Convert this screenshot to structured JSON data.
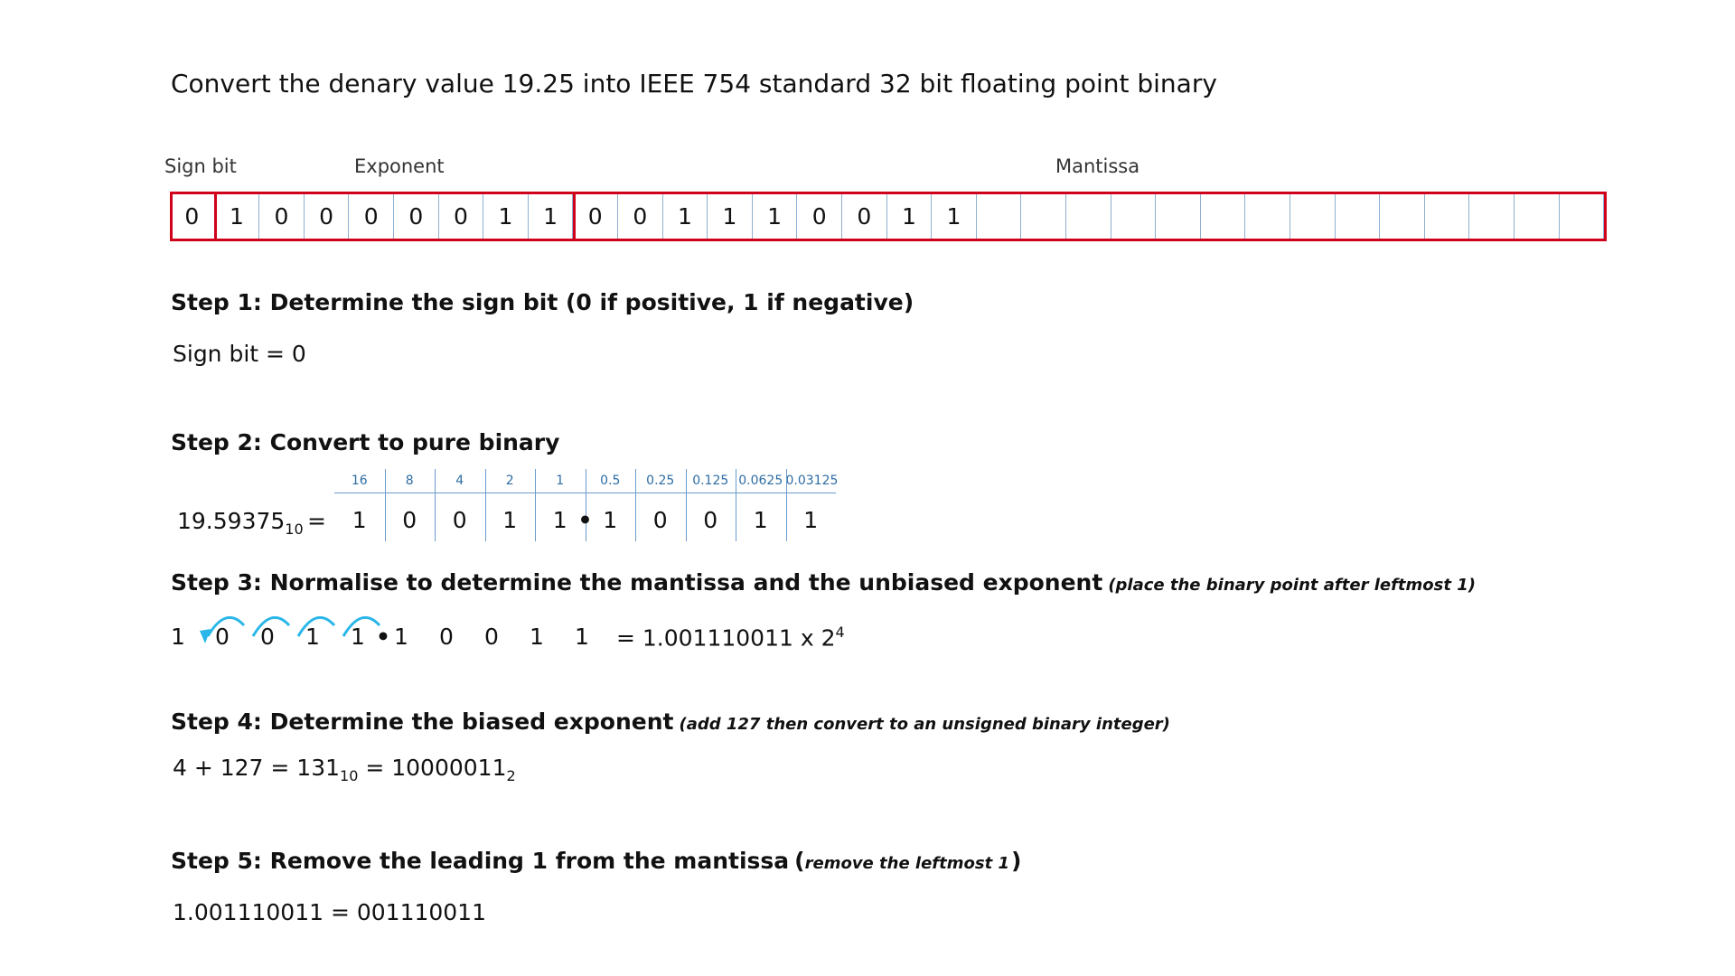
{
  "title": "Convert the denary value 19.25 into IEEE 754 standard 32 bit floating point binary",
  "fields": {
    "sign_label": "Sign bit",
    "exponent_label": "Exponent",
    "mantissa_label": "Mantissa"
  },
  "bits": [
    "0",
    "1",
    "0",
    "0",
    "0",
    "0",
    "0",
    "1",
    "1",
    "0",
    "0",
    "1",
    "1",
    "1",
    "0",
    "0",
    "1",
    "1",
    "",
    "",
    "",
    "",
    "",
    "",
    "",
    "",
    "",
    "",
    "",
    "",
    "",
    ""
  ],
  "colors": {
    "group_border": "#d0021b",
    "cell_divider": "#8fb0d0",
    "place_value_text": "#2e6da4",
    "arc": "#29b6e8"
  },
  "step1": {
    "heading": "Step 1: Determine the sign bit (0 if positive, 1 if negative)",
    "value": "Sign bit  =  0"
  },
  "step2": {
    "heading": "Step 2: Convert to pure binary",
    "number": "19.59375",
    "base": "10",
    "equals": "=",
    "place_values": [
      "16",
      "8",
      "4",
      "2",
      "1",
      "0.5",
      "0.25",
      "0.125",
      "0.0625",
      "0.03125"
    ],
    "binary_digits": [
      "1",
      "0",
      "0",
      "1",
      "1",
      "1",
      "0",
      "0",
      "1",
      "1"
    ],
    "point_symbol": "•"
  },
  "step3": {
    "heading": "Step 3: Normalise to determine the mantissa and the unbiased exponent",
    "note": "(place the binary point after leftmost 1)",
    "digits": [
      "1",
      "0",
      "0",
      "1",
      "1",
      "1",
      "0",
      "0",
      "1",
      "1"
    ],
    "point_symbol": "•",
    "result_prefix": "=  1.001110011 x 2",
    "result_power": "4"
  },
  "step4": {
    "heading": "Step 4: Determine the biased exponent",
    "note": "(add 127 then convert to an unsigned binary integer)",
    "expr_part1": "4 + 127 = 131",
    "expr_sub1": "10",
    "expr_part2": " =  10000011",
    "expr_sub2": "2"
  },
  "step5": {
    "heading": "Step 5: Remove the leading 1 from the mantissa",
    "note_open": "(",
    "note": "remove the leftmost 1",
    "note_close": ")",
    "value": "1.001110011  = 001110011"
  }
}
